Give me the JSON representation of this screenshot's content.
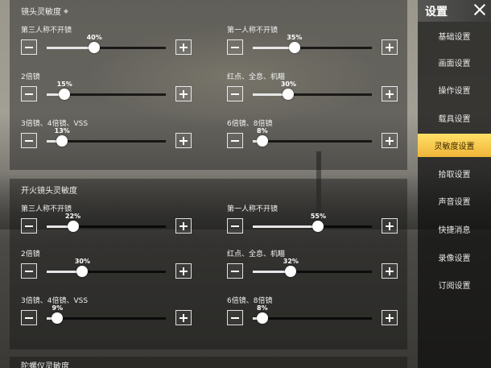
{
  "sidebar": {
    "title": "设置",
    "items": [
      {
        "label": "基础设置",
        "active": false
      },
      {
        "label": "画面设置",
        "active": false
      },
      {
        "label": "操作设置",
        "active": false
      },
      {
        "label": "载具设置",
        "active": false
      },
      {
        "label": "灵敏度设置",
        "active": true
      },
      {
        "label": "拾取设置",
        "active": false
      },
      {
        "label": "声音设置",
        "active": false
      },
      {
        "label": "快捷消息",
        "active": false
      },
      {
        "label": "录像设置",
        "active": false
      },
      {
        "label": "订阅设置",
        "active": false
      }
    ]
  },
  "sections": [
    {
      "title": "镜头灵敏度",
      "rows": [
        {
          "label": "第三人称不开镜",
          "value": 40,
          "value_text": "40%"
        },
        {
          "label": "第一人称不开镜",
          "value": 35,
          "value_text": "35%"
        },
        {
          "label": "2倍镜",
          "value": 15,
          "value_text": "15%"
        },
        {
          "label": "红点、全息、机瞄",
          "value": 30,
          "value_text": "30%"
        },
        {
          "label": "3倍镜、4倍镜、VSS",
          "value": 13,
          "value_text": "13%"
        },
        {
          "label": "6倍镜、8倍镜",
          "value": 8,
          "value_text": "8%"
        }
      ]
    },
    {
      "title": "开火镜头灵敏度",
      "rows": [
        {
          "label": "第三人称不开镜",
          "value": 22,
          "value_text": "22%"
        },
        {
          "label": "第一人称不开镜",
          "value": 55,
          "value_text": "55%"
        },
        {
          "label": "2倍镜",
          "value": 30,
          "value_text": "30%"
        },
        {
          "label": "红点、全息、机瞄",
          "value": 32,
          "value_text": "32%"
        },
        {
          "label": "3倍镜、4倍镜、VSS",
          "value": 9,
          "value_text": "9%"
        },
        {
          "label": "6倍镜、8倍镜",
          "value": 8,
          "value_text": "8%"
        }
      ]
    },
    {
      "title": "陀螺仪灵敏度",
      "rows": []
    }
  ],
  "colors": {
    "accent": "#f5c23e",
    "panel": "#141414",
    "text": "#f2f2f2"
  },
  "icons": {
    "minus": "minus-icon",
    "plus": "plus-icon",
    "close": "close-icon"
  },
  "slider_scale": {
    "min": 0,
    "max": 100,
    "knob_min_value": 5
  }
}
